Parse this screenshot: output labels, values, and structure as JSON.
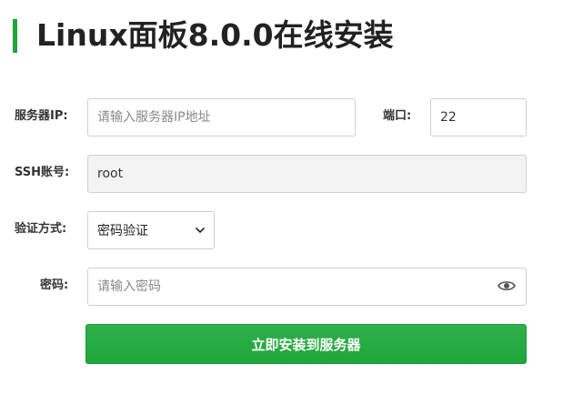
{
  "page": {
    "title": "Linux面板8.0.0在线安装"
  },
  "form": {
    "server_ip": {
      "label": "服务器IP:",
      "value": "",
      "placeholder": "请输入服务器IP地址"
    },
    "port": {
      "label": "端口:",
      "value": "22"
    },
    "ssh_account": {
      "label": "SSH账号:",
      "value": "root"
    },
    "auth_method": {
      "label": "验证方式:",
      "selected": "密码验证"
    },
    "password": {
      "label": "密码:",
      "value": "",
      "placeholder": "请输入密码"
    },
    "submit_label": "立即安装到服务器"
  },
  "icons": {
    "password_toggle": "eye-icon",
    "select_arrow": "chevron-down-icon"
  },
  "colors": {
    "accent": "#20a53a",
    "text": "#333333",
    "border": "#cfcfcf"
  }
}
